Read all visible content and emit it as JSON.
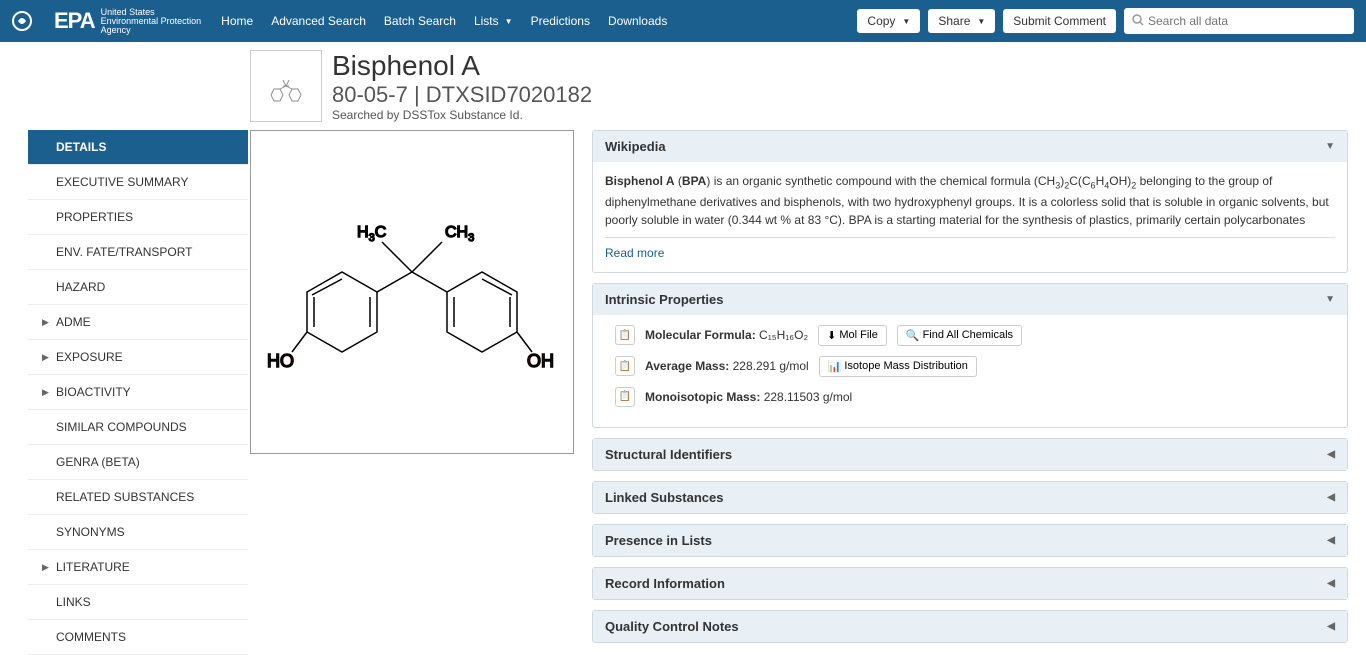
{
  "header": {
    "org_us": "United States",
    "org_name": "Environmental Protection",
    "org_agency": "Agency",
    "nav": [
      "Home",
      "Advanced Search",
      "Batch Search",
      "Lists",
      "Predictions",
      "Downloads"
    ],
    "copy": "Copy",
    "share": "Share",
    "submit": "Submit Comment",
    "search_placeholder": "Search all data"
  },
  "title": {
    "name": "Bisphenol A",
    "sub": "80-05-7 | DTXSID7020182",
    "searched": "Searched by DSSTox Substance Id."
  },
  "sidebar": [
    {
      "label": "DETAILS",
      "active": true,
      "expand": false
    },
    {
      "label": "EXECUTIVE SUMMARY",
      "expand": false
    },
    {
      "label": "PROPERTIES",
      "expand": false
    },
    {
      "label": "ENV. FATE/TRANSPORT",
      "expand": false
    },
    {
      "label": "HAZARD",
      "expand": false
    },
    {
      "label": "ADME",
      "expand": true
    },
    {
      "label": "EXPOSURE",
      "expand": true
    },
    {
      "label": "BIOACTIVITY",
      "expand": true
    },
    {
      "label": "SIMILAR COMPOUNDS",
      "expand": false
    },
    {
      "label": "GENRA (BETA)",
      "expand": false
    },
    {
      "label": "RELATED SUBSTANCES",
      "expand": false
    },
    {
      "label": "SYNONYMS",
      "expand": false
    },
    {
      "label": "LITERATURE",
      "expand": true
    },
    {
      "label": "LINKS",
      "expand": false
    },
    {
      "label": "COMMENTS",
      "expand": false
    }
  ],
  "wiki": {
    "title": "Wikipedia",
    "text_prefix": "Bisphenol A",
    "text_abbrev": "BPA",
    "text_body1": ") is an organic synthetic compound with the chemical formula (CH",
    "text_body2": "C(C",
    "text_body3": "OH)",
    "text_body4": " belonging to the group of diphenylmethane derivatives and bisphenols, with two hydroxyphenyl groups. It is a colorless solid that is soluble in organic solvents, but poorly soluble in water (0.344 wt % at 83 °C). BPA is a starting material for the synthesis of plastics, primarily certain polycarbonates",
    "readmore": "Read more"
  },
  "intrinsic": {
    "title": "Intrinsic Properties",
    "mol_formula_label": "Molecular Formula:",
    "mol_formula_value": "C₁₅H₁₆O₂",
    "mol_file": "Mol File",
    "find_all": "Find All Chemicals",
    "avg_mass_label": "Average Mass:",
    "avg_mass_value": "228.291 g/mol",
    "isotope": "Isotope Mass Distribution",
    "mono_label": "Monoisotopic Mass:",
    "mono_value": "228.11503 g/mol"
  },
  "collapsed_panels": [
    "Structural Identifiers",
    "Linked Substances",
    "Presence in Lists",
    "Record Information",
    "Quality Control Notes"
  ]
}
